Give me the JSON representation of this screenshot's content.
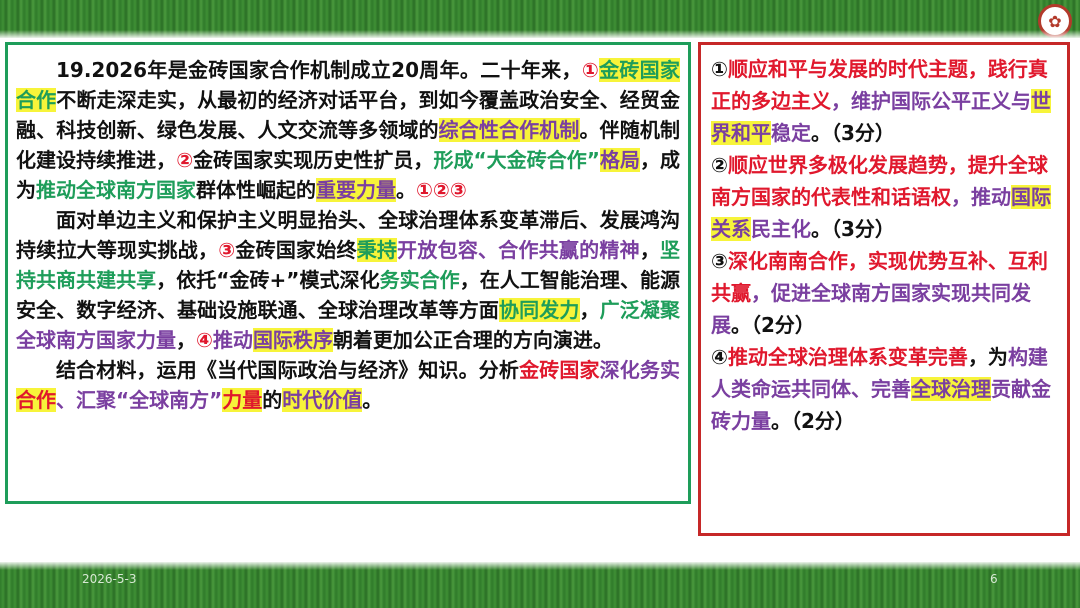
{
  "footer": {
    "date": "2026-5-3",
    "page": "6"
  },
  "left_panel": {
    "para1": [
      {
        "text": "19.2026年是金砖国家合作机制成立20周年。二十年来，",
        "c": "blk"
      },
      {
        "text": "①",
        "c": "red"
      },
      {
        "text": "金砖国家合作",
        "c": "green",
        "hl": true
      },
      {
        "text": "不断走深走实，从最初的经济对话平台，到如今覆盖政治安全、经贸金融、科技创新、绿色发展、人文交流等多领域的",
        "c": "blk"
      },
      {
        "text": "综合性合作机制",
        "c": "purple",
        "hl": true
      },
      {
        "text": "。伴随机制化建设持续推进，",
        "c": "blk"
      },
      {
        "text": "②",
        "c": "red"
      },
      {
        "text": "金砖国家实现历史性扩员，",
        "c": "blk"
      },
      {
        "text": "形成“大金砖合作”",
        "c": "green"
      },
      {
        "text": "格局",
        "c": "purple",
        "hl": true
      },
      {
        "text": "，成为",
        "c": "blk"
      },
      {
        "text": "推动全球南方国家",
        "c": "green"
      },
      {
        "text": "群体性崛起的",
        "c": "blk"
      },
      {
        "text": "重要力量",
        "c": "purple",
        "hl": true
      },
      {
        "text": "。",
        "c": "blk"
      },
      {
        "text": "①②③",
        "c": "red"
      }
    ],
    "para2": [
      {
        "text": "面对单边主义和保护主义明显抬头、全球治理体系变革滞后、发展鸿沟持续拉大等现实挑战，",
        "c": "blk"
      },
      {
        "text": "③",
        "c": "red"
      },
      {
        "text": "金砖国家始终",
        "c": "blk"
      },
      {
        "text": "秉持",
        "c": "green",
        "hl": true
      },
      {
        "text": "开放包容、合作共赢的精神",
        "c": "purple"
      },
      {
        "text": "，",
        "c": "blk"
      },
      {
        "text": "坚持共商共建共享",
        "c": "green"
      },
      {
        "text": "，依托“金砖+”模式深化",
        "c": "blk"
      },
      {
        "text": "务实合作",
        "c": "green"
      },
      {
        "text": "，在人工智能治理、能源安全、数字经济、基础设施联通、全球治理改革等方面",
        "c": "blk"
      },
      {
        "text": "协同发力",
        "c": "green",
        "hl": true
      },
      {
        "text": "，",
        "c": "blk"
      },
      {
        "text": "广泛凝聚",
        "c": "green"
      },
      {
        "text": "全球南方国家力量",
        "c": "purple"
      },
      {
        "text": "，",
        "c": "blk"
      },
      {
        "text": "④",
        "c": "red"
      },
      {
        "text": "推动",
        "c": "purple"
      },
      {
        "text": "国际秩序",
        "c": "purple",
        "hl": true
      },
      {
        "text": "朝着更加公正合理的方向演进。",
        "c": "blk"
      }
    ],
    "para3": [
      {
        "text": "结合材料，运用《当代国际政治与经济》知识。分析",
        "c": "blk"
      },
      {
        "text": "金砖国家",
        "c": "red"
      },
      {
        "text": "深化务实",
        "c": "purple"
      },
      {
        "text": "合作",
        "c": "red",
        "hl": true
      },
      {
        "text": "、汇聚“全球南方”",
        "c": "purple"
      },
      {
        "text": "力量",
        "c": "red",
        "hl": true
      },
      {
        "text": "的",
        "c": "blk"
      },
      {
        "text": "时代价值",
        "c": "purple",
        "hl": true
      },
      {
        "text": "。",
        "c": "blk"
      }
    ]
  },
  "right_panel": {
    "items": [
      [
        {
          "text": "①",
          "c": "blk"
        },
        {
          "text": "顺应和平与发展的时代主题，践行真正的多边主义",
          "c": "red"
        },
        {
          "text": "，维护",
          "c": "purple"
        },
        {
          "text": "国际公平正义与",
          "c": "purple"
        },
        {
          "text": "世界和平",
          "c": "purple",
          "hl": true
        },
        {
          "text": "稳定",
          "c": "purple"
        },
        {
          "text": "。（3分）",
          "c": "blk"
        }
      ],
      [
        {
          "text": "②",
          "c": "blk"
        },
        {
          "text": "顺应世界多极化发展趋势，提升全球南方国家的代表性和话语权",
          "c": "red"
        },
        {
          "text": "，推动",
          "c": "purple"
        },
        {
          "text": "国际关系",
          "c": "purple",
          "hl": true
        },
        {
          "text": "民主化",
          "c": "purple"
        },
        {
          "text": "。（3分）",
          "c": "blk"
        }
      ],
      [
        {
          "text": "③",
          "c": "blk"
        },
        {
          "text": "深化南南合作，实现优势互补、互利共赢",
          "c": "red"
        },
        {
          "text": "，促进全球南方国家实现共同发展",
          "c": "purple"
        },
        {
          "text": "。（2分）",
          "c": "blk"
        }
      ],
      [
        {
          "text": "④",
          "c": "blk"
        },
        {
          "text": "推动全球治理体系变革完善",
          "c": "red"
        },
        {
          "text": "，为",
          "c": "blk"
        },
        {
          "text": "构建人类命运共同体",
          "c": "purple"
        },
        {
          "text": "、完善",
          "c": "purple"
        },
        {
          "text": "全球治理",
          "c": "purple",
          "hl": true
        },
        {
          "text": "贡献金砖力量",
          "c": "purple"
        },
        {
          "text": "。（2分）",
          "c": "blk"
        }
      ]
    ]
  }
}
